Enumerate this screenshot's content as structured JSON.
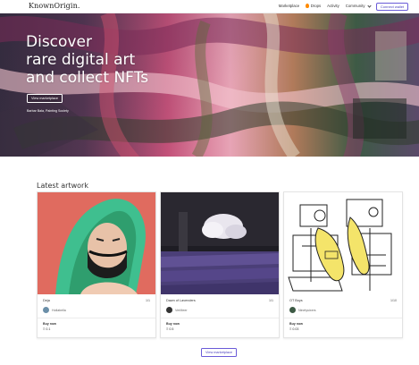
{
  "nav": {
    "logo": "KnownOrigin.",
    "links": {
      "marketplace": "Marketplace",
      "drops": "Drops",
      "activity": "Activity",
      "community": "Community"
    },
    "connect_label": "Connect wallet"
  },
  "hero": {
    "title_lines": [
      "Discover",
      "rare digital art",
      "and collect NFTs"
    ],
    "button_label": "View marketplace",
    "credit": "Barbar Bala, Painting Society"
  },
  "latest": {
    "title": "Latest artwork",
    "cards": [
      {
        "title": "Deja",
        "edition": "1/1",
        "artist": "Hollabella",
        "buy_label": "Buy now",
        "price": "Ξ 0.1",
        "avatar_color": "#6b8fa8"
      },
      {
        "title": "Dawn of Lavenders",
        "edition": "1/1",
        "artist": "VerMeer",
        "buy_label": "Buy now",
        "price": "Ξ 0.5",
        "avatar_color": "#333333"
      },
      {
        "title": "OT Boys",
        "edition": "1/10",
        "artist": "Ninetysixers",
        "buy_label": "Buy now",
        "price": "Ξ 0.03",
        "avatar_color": "#3d5a45"
      }
    ],
    "view_label": "View marketplace"
  },
  "colors": {
    "accent": "#4b3fc0",
    "drops_flame": "#ff8a00"
  },
  "icons": {
    "drops": "flame-icon",
    "community": "chevron-down-icon"
  }
}
